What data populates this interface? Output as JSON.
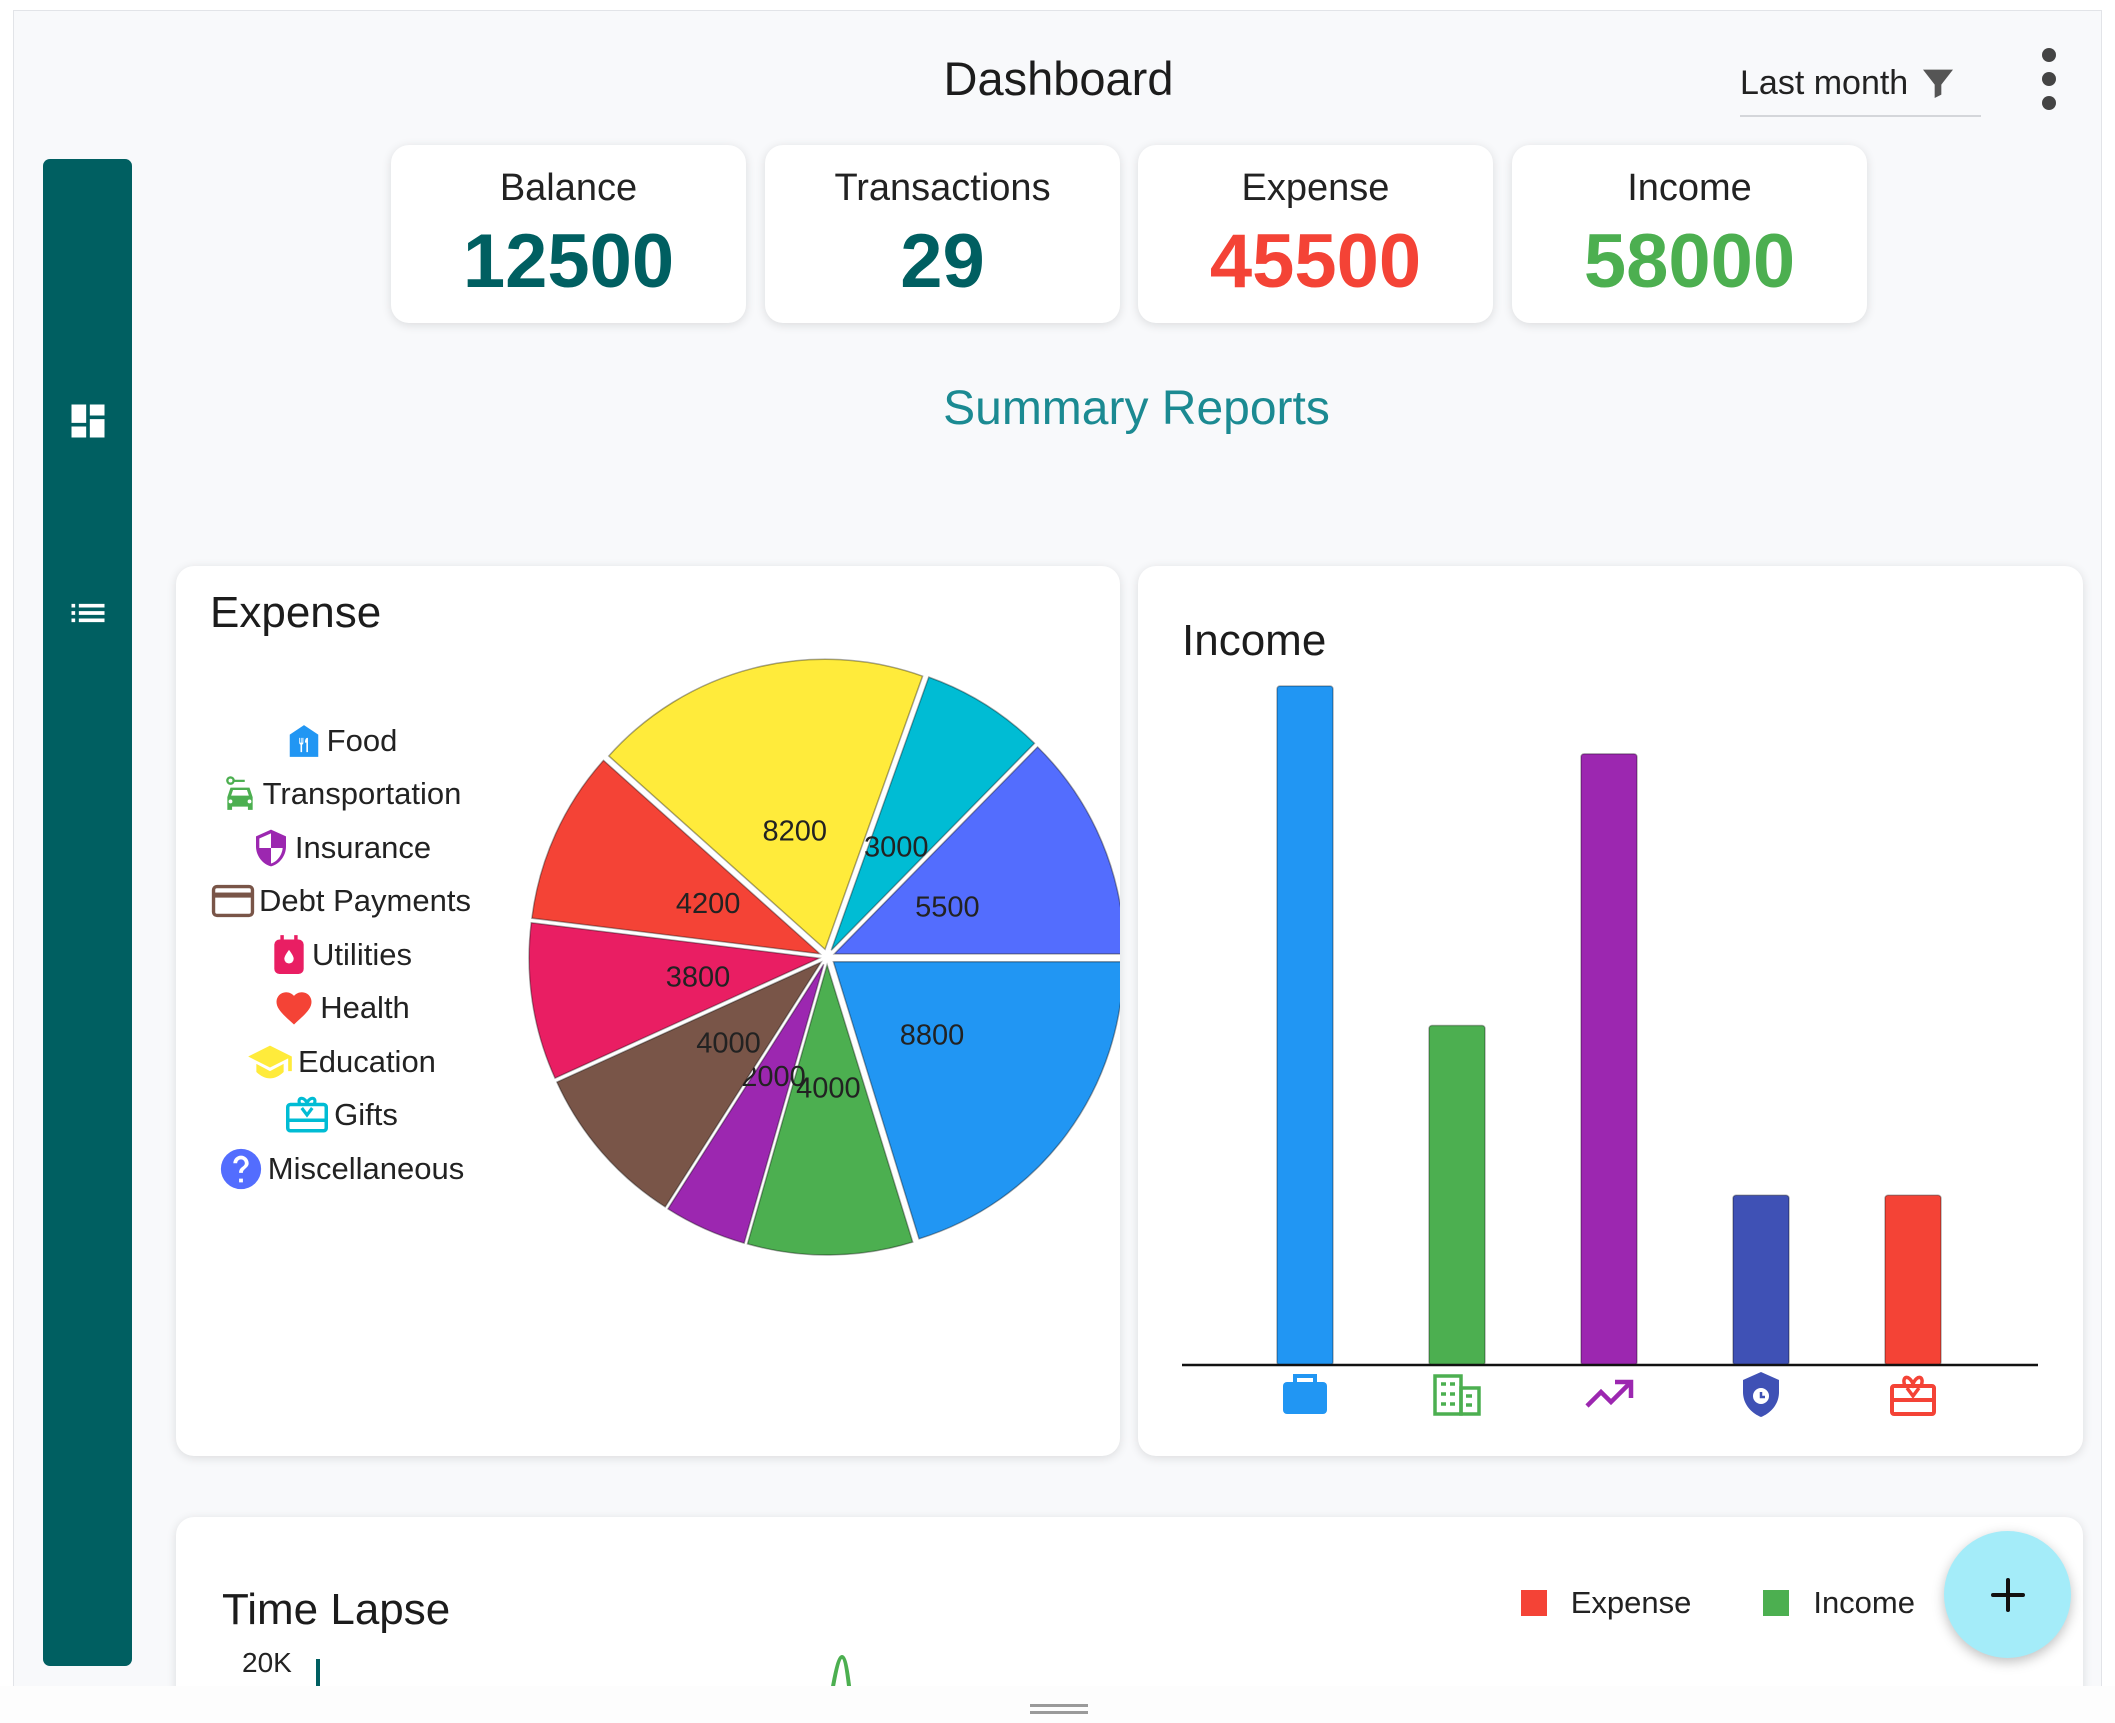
{
  "header": {
    "title": "Dashboard",
    "period_filter": "Last month",
    "filter_icon": "filter-icon",
    "more_icon": "more-vert-icon"
  },
  "sidebar": {
    "items": [
      {
        "icon": "dashboard-icon"
      },
      {
        "icon": "list-icon"
      }
    ]
  },
  "stats": [
    {
      "label": "Balance",
      "value": "12500",
      "color": "#005f61"
    },
    {
      "label": "Transactions",
      "value": "29",
      "color": "#005f61"
    },
    {
      "label": "Expense",
      "value": "45500",
      "color": "#f44336"
    },
    {
      "label": "Income",
      "value": "58000",
      "color": "#4caf50"
    }
  ],
  "summary_title": "Summary Reports",
  "expense_card": {
    "title": "Expense",
    "legend": [
      {
        "label": "Food",
        "icon": "food-icon",
        "color": "#2196f3"
      },
      {
        "label": "Transportation",
        "icon": "car-icon",
        "color": "#4caf50"
      },
      {
        "label": "Insurance",
        "icon": "shield-icon",
        "color": "#9c27b0"
      },
      {
        "label": "Debt Payments",
        "icon": "credit-card-icon",
        "color": "#795548"
      },
      {
        "label": "Utilities",
        "icon": "utilities-icon",
        "color": "#e91e63"
      },
      {
        "label": "Health",
        "icon": "heart-icon",
        "color": "#f44336"
      },
      {
        "label": "Education",
        "icon": "graduation-cap-icon",
        "color": "#ffeb3b"
      },
      {
        "label": "Gifts",
        "icon": "gift-card-icon",
        "color": "#00bcd4"
      },
      {
        "label": "Miscellaneous",
        "icon": "help-icon",
        "color": "#536dfe"
      }
    ]
  },
  "income_card": {
    "title": "Income",
    "categories": [
      {
        "icon": "briefcase-icon",
        "color": "#2196f3"
      },
      {
        "icon": "building-icon",
        "color": "#4caf50"
      },
      {
        "icon": "trending-up-icon",
        "color": "#9c27b0"
      },
      {
        "icon": "security-icon",
        "color": "#3f51b5"
      },
      {
        "icon": "gift-card-icon",
        "color": "#f44336"
      }
    ]
  },
  "timelapse_card": {
    "title": "Time Lapse",
    "y_tick_top": "20K",
    "legend": [
      {
        "label": "Expense",
        "color": "#f44336"
      },
      {
        "label": "Income",
        "color": "#4caf50"
      }
    ]
  },
  "fab_icon": "add-icon",
  "chart_data": [
    {
      "type": "pie",
      "title": "Expense",
      "slices": [
        {
          "value": 8800,
          "color": "#2196f3"
        },
        {
          "value": 4000,
          "color": "#4caf50"
        },
        {
          "value": 2000,
          "color": "#9c27b0"
        },
        {
          "value": 4000,
          "color": "#795548"
        },
        {
          "value": 3800,
          "color": "#e91e63"
        },
        {
          "value": 4200,
          "color": "#f44336"
        },
        {
          "value": 8200,
          "color": "#ffeb3b"
        },
        {
          "value": 3000,
          "color": "#00bcd4"
        },
        {
          "value": 5500,
          "color": "#536dfe"
        }
      ]
    },
    {
      "type": "bar",
      "title": "Income",
      "values": [
        20000,
        10000,
        18000,
        5000,
        5000
      ],
      "ylim": [
        0,
        20000
      ],
      "colors": [
        "#2196f3",
        "#4caf50",
        "#9c27b0",
        "#3f51b5",
        "#f44336"
      ]
    }
  ]
}
